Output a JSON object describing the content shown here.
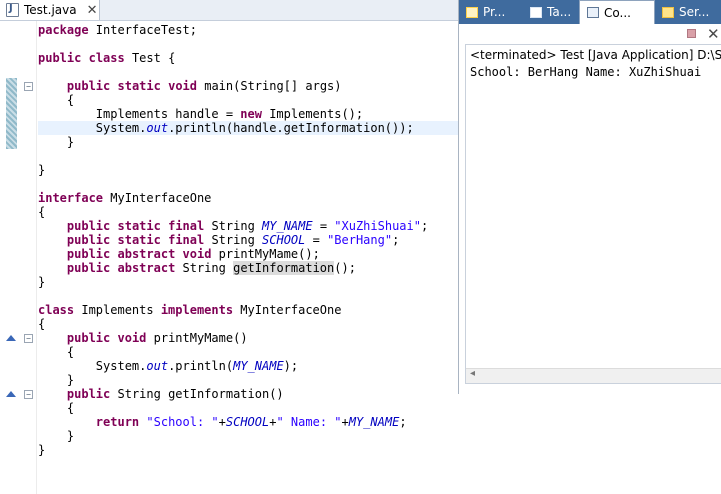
{
  "editor": {
    "tab_label": "Test.java",
    "lines": [
      "package InterfaceTest;",
      "",
      "public class Test {",
      "",
      "    public static void main(String[] args)",
      "    {",
      "        Implements handle = new Implements();",
      "        System.out.println(handle.getInformation());",
      "    }",
      "",
      "}",
      "",
      "interface MyInterfaceOne",
      "{",
      "    public static final String MY_NAME = \"XuZhiShuai\";",
      "    public static final String SCHOOL = \"BerHang\";",
      "    public abstract void printMyMame();",
      "    public abstract String getInformation();",
      "}",
      "",
      "class Implements implements MyInterfaceOne",
      "{",
      "    public void printMyMame()",
      "    {",
      "        System.out.println(MY_NAME);",
      "    }",
      "    public String getInformation()",
      "    {",
      "        return \"School: \"+SCHOOL+\" Name: \"+MY_NAME;",
      "    }",
      "}"
    ]
  },
  "views": {
    "tabs": [
      "Pr...",
      "Ta...",
      "Co...",
      "Ser..."
    ],
    "active_tab": "Co..."
  },
  "console": {
    "header": "<terminated> Test [Java Application] D:\\SO",
    "output": "School: BerHang Name: XuZhiShuai"
  },
  "icons": {
    "tab_file": "java-file-icon",
    "tab_close": "close-icon",
    "console_terminate": "terminate-icon",
    "console_remove": "remove-launch-icon",
    "fold": "fold-collapse-icon",
    "override": "override-marker-icon"
  },
  "colors": {
    "keyword": "#7f0055",
    "string": "#2a00ff",
    "static_field": "#0000c0",
    "view_tabbar": "#3f6b9e",
    "current_line": "#e8f2fe"
  }
}
